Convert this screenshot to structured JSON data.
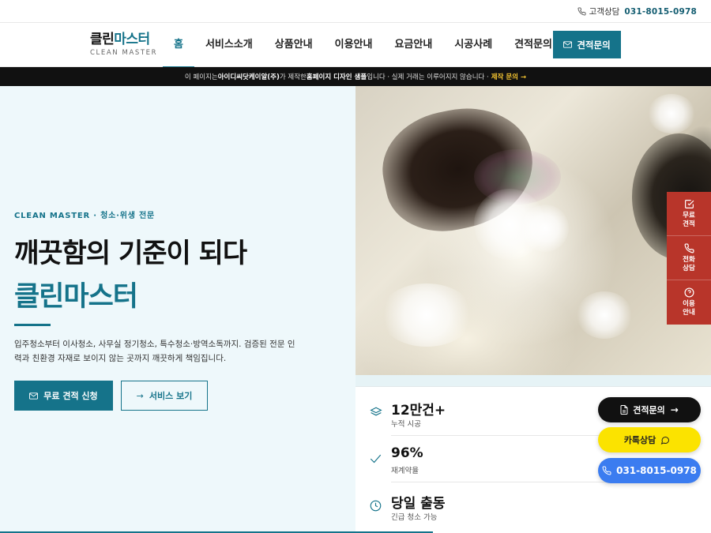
{
  "topbar": {
    "contact_label": "고객상담",
    "phone": "031-8015-0978",
    "icon": "phone-icon"
  },
  "header": {
    "logo_ko_part1": "클린",
    "logo_ko_part2": "마스터",
    "logo_en": "CLEAN MASTER",
    "nav": [
      {
        "label": "홈",
        "active": true
      },
      {
        "label": "서비스소개",
        "active": false
      },
      {
        "label": "상품안내",
        "active": false
      },
      {
        "label": "이용안내",
        "active": false
      },
      {
        "label": "요금안내",
        "active": false
      },
      {
        "label": "시공사례",
        "active": false
      },
      {
        "label": "견적문의",
        "active": false
      }
    ],
    "quote_button": "견적문의",
    "quote_icon": "mail-icon",
    "accent_color": "#15738a"
  },
  "notice": {
    "part1": "이 페이지는 ",
    "company": "아이디씨닷케이알(주)",
    "part2": "가 제작한 ",
    "sample": "홈페이지 디자인 샘플",
    "part3": "입니다 · 실제 거래는 이루어지지 않습니다 · ",
    "cta": "제작 문의 →"
  },
  "hero": {
    "eyebrow": "CLEAN MASTER · 청소·위생 전문",
    "title_line1": "깨끗함의 기준이 되다",
    "title_line2": "클린마스터",
    "description": "입주청소부터 이사청소, 사무실 정기청소, 특수청소·방역소독까지. 검증된 전문 인력과 친환경 자재로 보이지 않는 곳까지 깨끗하게 책임집니다.",
    "primary_button": "무료 견적 신청",
    "secondary_button": "서비스 보기",
    "secondary_arrow": "→"
  },
  "side_menu": [
    {
      "label_line1": "무료",
      "label_line2": "견적",
      "icon": "checkbox-icon"
    },
    {
      "label_line1": "전화",
      "label_line2": "상담",
      "icon": "phone-icon"
    },
    {
      "label_line1": "이용",
      "label_line2": "안내",
      "icon": "help-circle-icon"
    }
  ],
  "stats": [
    {
      "value": "12만건+",
      "label": "누적 시공",
      "icon": "layers-icon"
    },
    {
      "value": "96%",
      "label": "재계약율",
      "icon": "check-icon"
    },
    {
      "value": "당일 출동",
      "label": "긴급 청소 가능",
      "icon": "clock-icon"
    }
  ],
  "floating": {
    "quote": "견적문의",
    "quote_arrow": "→",
    "kakao": "카톡상담",
    "phone": "031-8015-0978"
  }
}
